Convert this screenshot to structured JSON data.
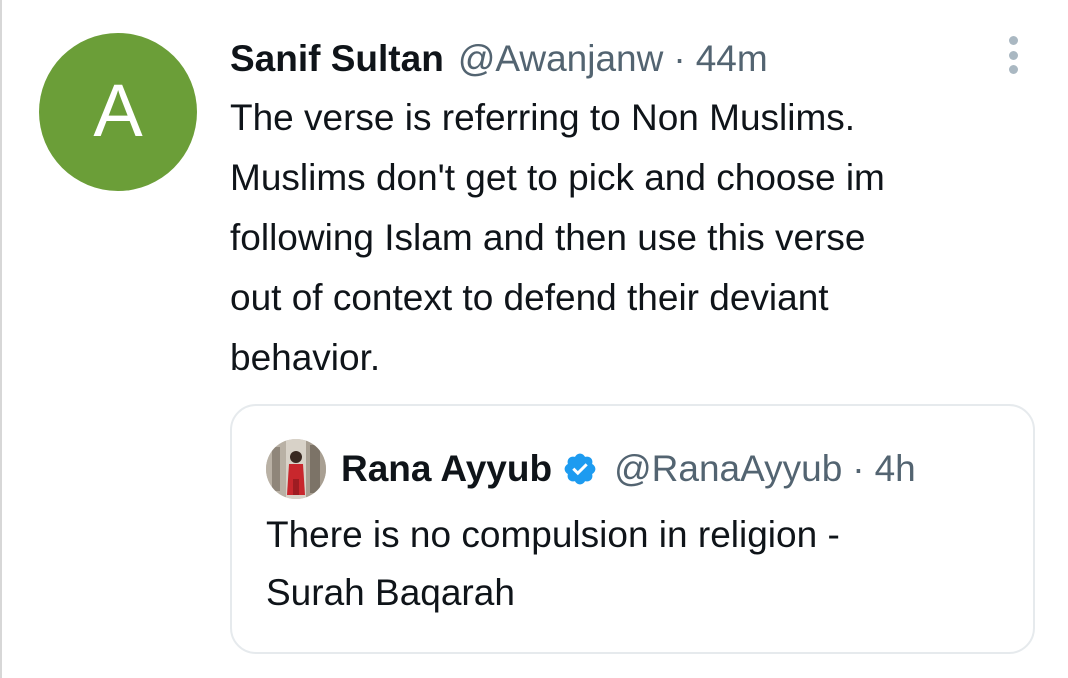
{
  "tweet": {
    "avatar_letter": "A",
    "avatar_color": "#6b9e38",
    "display_name": "Sanif Sultan",
    "handle": "@Awanjanw",
    "separator": "·",
    "time": "44m",
    "more_icon": "more-vertical-icon",
    "text_lines": [
      "The verse is referring to Non Muslims.",
      "Muslims don't get to pick and choose im",
      "following Islam and then use this verse",
      "out of context to defend their deviant",
      "behavior."
    ]
  },
  "quoted_tweet": {
    "avatar_icon": "profile-photo",
    "display_name": "Rana Ayyub",
    "verified_icon": "verified-badge-icon",
    "verified_color": "#1d9bf0",
    "handle": "@RanaAyyub",
    "separator": "·",
    "time": "4h",
    "text_lines": [
      "There is no compulsion in religion -",
      "Surah Baqarah"
    ]
  }
}
